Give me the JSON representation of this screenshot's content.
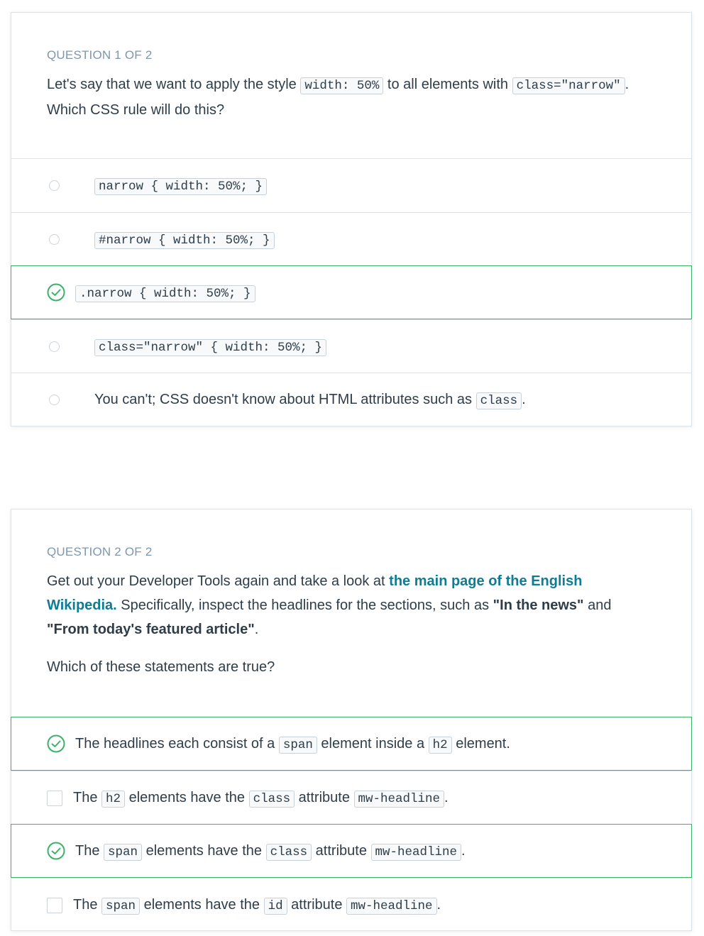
{
  "q1": {
    "label": "QUESTION 1 OF 2",
    "text_a": "Let's say that we want to apply the style ",
    "code_a": "width: 50%",
    "text_b": " to all elements with ",
    "code_b": "class=\"narrow\"",
    "text_c": ". Which CSS rule will do this?",
    "options": [
      {
        "code": "narrow { width: 50%; }",
        "selected": false
      },
      {
        "code": "#narrow { width: 50%; }",
        "selected": false
      },
      {
        "code": ".narrow { width: 50%; }",
        "selected": true
      },
      {
        "code": "class=\"narrow\" { width: 50%; }",
        "selected": false
      },
      {
        "text": "You can't; CSS doesn't know about HTML attributes such as ",
        "code": "class",
        "tail": ".",
        "selected": false
      }
    ]
  },
  "q2": {
    "label": "QUESTION 2 OF 2",
    "p1_a": "Get out your Developer Tools again and take a look at ",
    "p1_link": "the main page of the English Wikipedia.",
    "p1_b": " Specifically, inspect the headlines for the sections, such as ",
    "p1_bold1": "\"In the news\"",
    "p1_c": " and ",
    "p1_bold2": "\"From today's featured article\"",
    "p1_d": ".",
    "p2": "Which of these statements are true?",
    "options": [
      {
        "parts": [
          "The headlines each consist of a ",
          "span",
          " element inside a ",
          "h2",
          " element."
        ],
        "selected": true
      },
      {
        "parts": [
          "The ",
          "h2",
          " elements have the ",
          "class",
          " attribute ",
          "mw-headline",
          "."
        ],
        "selected": false
      },
      {
        "parts": [
          "The ",
          "span",
          " elements have the ",
          "class",
          " attribute ",
          "mw-headline",
          "."
        ],
        "selected": true
      },
      {
        "parts": [
          "The ",
          "span",
          " elements have the ",
          "id",
          " attribute ",
          "mw-headline",
          "."
        ],
        "selected": false
      }
    ]
  },
  "colors": {
    "correct": "#3ab26a",
    "label": "#7d97ad",
    "link": "#0f7c93",
    "text": "#2e3d49"
  },
  "icons": {
    "selected": "check-circle-icon",
    "unselected_radio": "radio-icon",
    "unselected_checkbox": "checkbox-icon"
  }
}
